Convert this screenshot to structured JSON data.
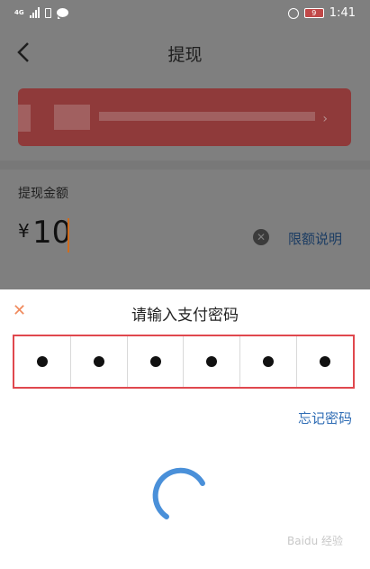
{
  "status_bar": {
    "network": "4G",
    "battery": "9",
    "time": "1:41",
    "icons": [
      "signal-icon",
      "phone-icon",
      "chat-icon",
      "alarm-icon",
      "battery-icon"
    ]
  },
  "header": {
    "title": "提现",
    "back_icon": "chevron-left-icon"
  },
  "withdraw": {
    "amount_label": "提现金额",
    "currency_symbol": "¥",
    "amount_value": "10",
    "limit_link": "限额说明"
  },
  "password_sheet": {
    "title": "请输入支付密码",
    "close_icon": "close-icon",
    "digits_filled": 6,
    "digits_total": 6,
    "forgot_link": "忘记密码"
  },
  "watermark": "Baidu 经验",
  "colors": {
    "overlay_gray": "#7f7f7f",
    "accent_blue": "#2f6db5",
    "highlight_red": "#e0484e",
    "caret_orange": "#d06c1e",
    "spinner_blue": "#4a90d9"
  }
}
